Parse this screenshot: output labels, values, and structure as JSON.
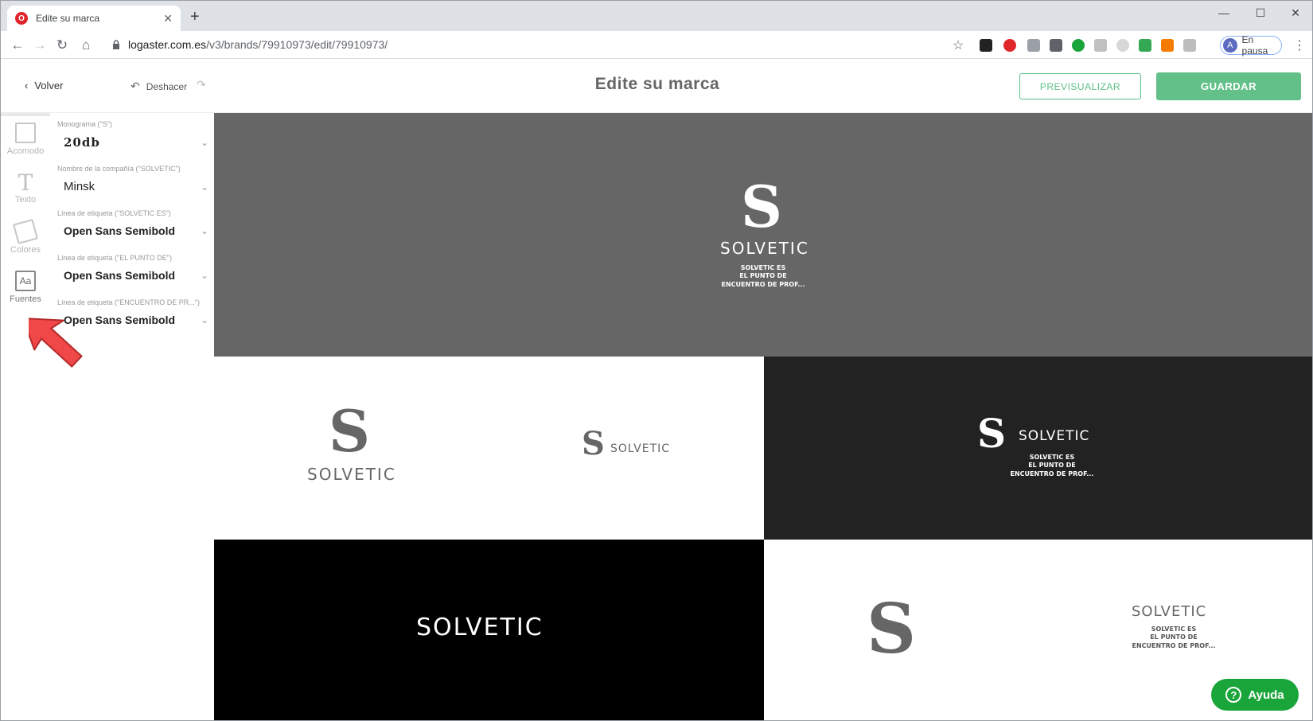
{
  "browser": {
    "tab_title": "Edite su marca",
    "new_tab": "+",
    "url_host": "logaster.com.es",
    "url_path": "/v3/brands/79910973/edit/79910973/",
    "profile_initial": "A",
    "profile_label": "En pausa"
  },
  "header": {
    "back_label": "Volver",
    "undo_label": "Deshacer",
    "title": "Edite su marca",
    "preview_label": "PREVISUALIZAR",
    "save_label": "GUARDAR"
  },
  "rail": {
    "items": [
      {
        "label": "Acomodo",
        "icon": "layout-icon"
      },
      {
        "label": "Texto",
        "icon": "text-icon"
      },
      {
        "label": "Colores",
        "icon": "palette-icon"
      },
      {
        "label": "Fuentes",
        "icon": "fonts-icon"
      }
    ]
  },
  "fonts": [
    {
      "label": "Monograma (\"S\")",
      "value": "20db"
    },
    {
      "label": "Nombre de la compañía (\"SOLVETIC\")",
      "value": "Minsk"
    },
    {
      "label": "Línea de etiqueta (\"SOLVETIC ES\")",
      "value": "Open Sans Semibold"
    },
    {
      "label": "Línea de etiqueta (\"EL PUNTO DE\")",
      "value": "Open Sans Semibold"
    },
    {
      "label": "Línea de etiqueta (\"ENCUENTRO DE PR...\")",
      "value": "Open Sans Semibold"
    }
  ],
  "logo": {
    "monogram": "S",
    "company": "SOLVETIC",
    "tag1": "SOLVETIC ES",
    "tag2": "EL PUNTO DE",
    "tag3": "ENCUENTRO DE PROF..."
  },
  "help_label": "Ayuda",
  "colors": {
    "accent_green": "#63c089",
    "help_green": "#1aa53b",
    "tile_gray": "#666666",
    "tile_dark": "#222222",
    "tile_black": "#000000"
  }
}
